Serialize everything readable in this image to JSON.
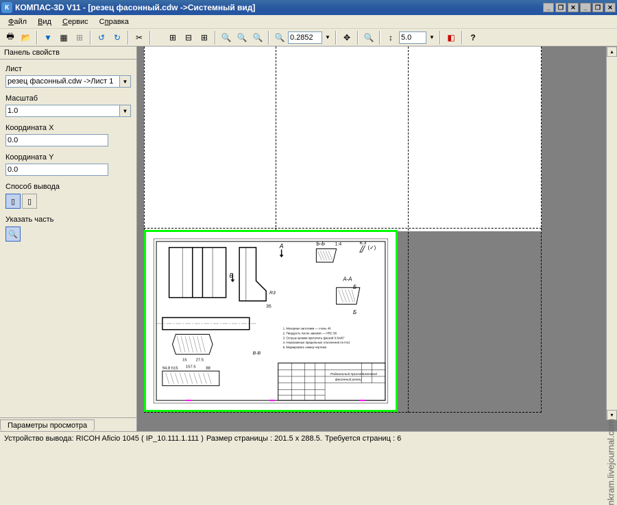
{
  "title": "КОМПАС-3D V11 - [резец фасонный.cdw ->Системный вид]",
  "menu": {
    "file": "Файл",
    "view": "Вид",
    "service": "Сервис",
    "help": "Справка"
  },
  "toolbar": {
    "zoom_value": "0.2852",
    "step_value": "5.0"
  },
  "panel": {
    "header": "Панель свойств",
    "sheet_label": "Лист",
    "sheet_value": "резец фасонный.cdw ->Лист 1",
    "scale_label": "Масштаб",
    "scale_value": "1.0",
    "coordx_label": "Координата X",
    "coordx_value": "0.0",
    "coordy_label": "Координата Y",
    "coordy_value": "0.0",
    "output_label": "Способ вывода",
    "point_label": "Указать часть"
  },
  "tabs": {
    "preview": "Параметры просмотра"
  },
  "status": {
    "device": "Устройство вывода: RICOH Aficio 1045 ( IP_10.111.1.111 )",
    "pagesize": "Размер страницы : 201.5 x 288.5.",
    "pages": "Требуется страниц : 6"
  },
  "watermark": "nkram.livejournal.com",
  "drawing": {
    "sectionA": "А",
    "sectionB": "Б",
    "sectionV": "В",
    "labelAA": "А-А",
    "labelBB": "Б-Б",
    "labelVV": "В-В",
    "dim35": "35",
    "dimR3": "R3"
  }
}
